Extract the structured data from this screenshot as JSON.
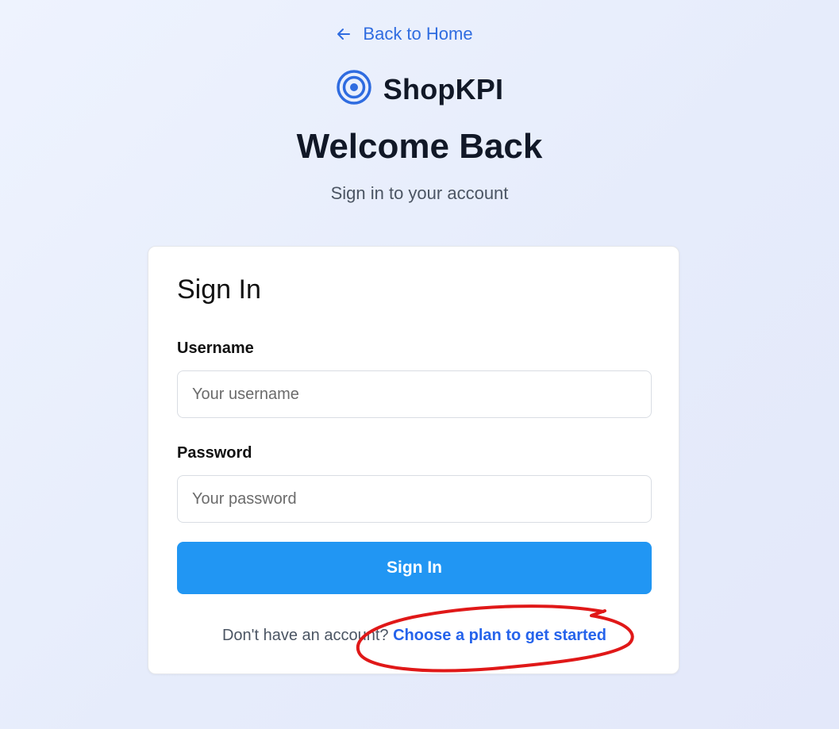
{
  "nav": {
    "back_label": "Back to Home"
  },
  "brand": {
    "name": "ShopKPI",
    "logo_icon": "target-icon",
    "accent_color": "#2f6ce0"
  },
  "header": {
    "title": "Welcome Back",
    "subtitle": "Sign in to your account"
  },
  "form": {
    "title": "Sign In",
    "username": {
      "label": "Username",
      "placeholder": "Your username",
      "value": ""
    },
    "password": {
      "label": "Password",
      "placeholder": "Your password",
      "value": ""
    },
    "submit_label": "Sign In",
    "submit_color": "#2196f3",
    "signup_prompt": "Don't have an account?",
    "signup_link": "Choose a plan to get started"
  },
  "annotation": {
    "shape": "freehand-circle",
    "color": "#e01818"
  }
}
